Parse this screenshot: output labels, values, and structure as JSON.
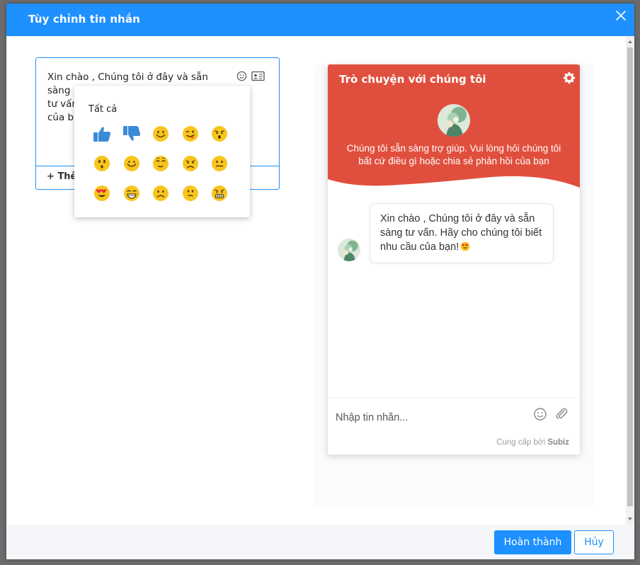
{
  "modal": {
    "title": "Tùy chỉnh tin nhắn",
    "close_icon": "close-icon"
  },
  "editor": {
    "text": "Xin chào , Chúng tôi ở đây và sẵn sàng tư vấn. Hãy cho chúng tôi biết nhu cầu của bạn!",
    "text_lines": [
      "Xin chào , Chúng tôi ở đây và sẵn sàng",
      "tư vấn",
      "của b"
    ],
    "icons": [
      "emoji-icon",
      "contact-card-icon"
    ],
    "add_label": "Thê"
  },
  "emoji_picker": {
    "category": "Tất cả",
    "emojis": [
      "thumbs-up",
      "thumbs-down",
      "smile",
      "tongue-wink",
      "angry-kiss",
      "surprised",
      "happy",
      "shy",
      "sad",
      "neutral",
      "heart-eyes",
      "grin",
      "frown",
      "thinking",
      "grimace"
    ]
  },
  "chat_preview": {
    "title": "Trò chuyện với chúng tôi",
    "subtitle": "Chúng tôi sẵn sàng trợ giúp. Vui lòng hỏi chúng tôi bất cứ điều gì hoặc chia sẻ phản hồi của bạn",
    "message": "Xin chào , Chúng tôi ở đây và sẵn sàng tư vấn. Hãy cho chúng tôi biết nhu cầu của bạn!",
    "input_placeholder": "Nhập tin nhắn...",
    "powered_by_prefix": "Cung cấp bởi",
    "powered_by_brand": "Subiz",
    "header_color": "#e04f3d"
  },
  "footer": {
    "done_label": "Hoàn thành",
    "cancel_label": "Hủy"
  },
  "colors": {
    "primary": "#1e90ff",
    "chat_header": "#e04f3d",
    "emoji_yellow": "#f7c51e",
    "thumb_blue": "#3b8ad8"
  }
}
